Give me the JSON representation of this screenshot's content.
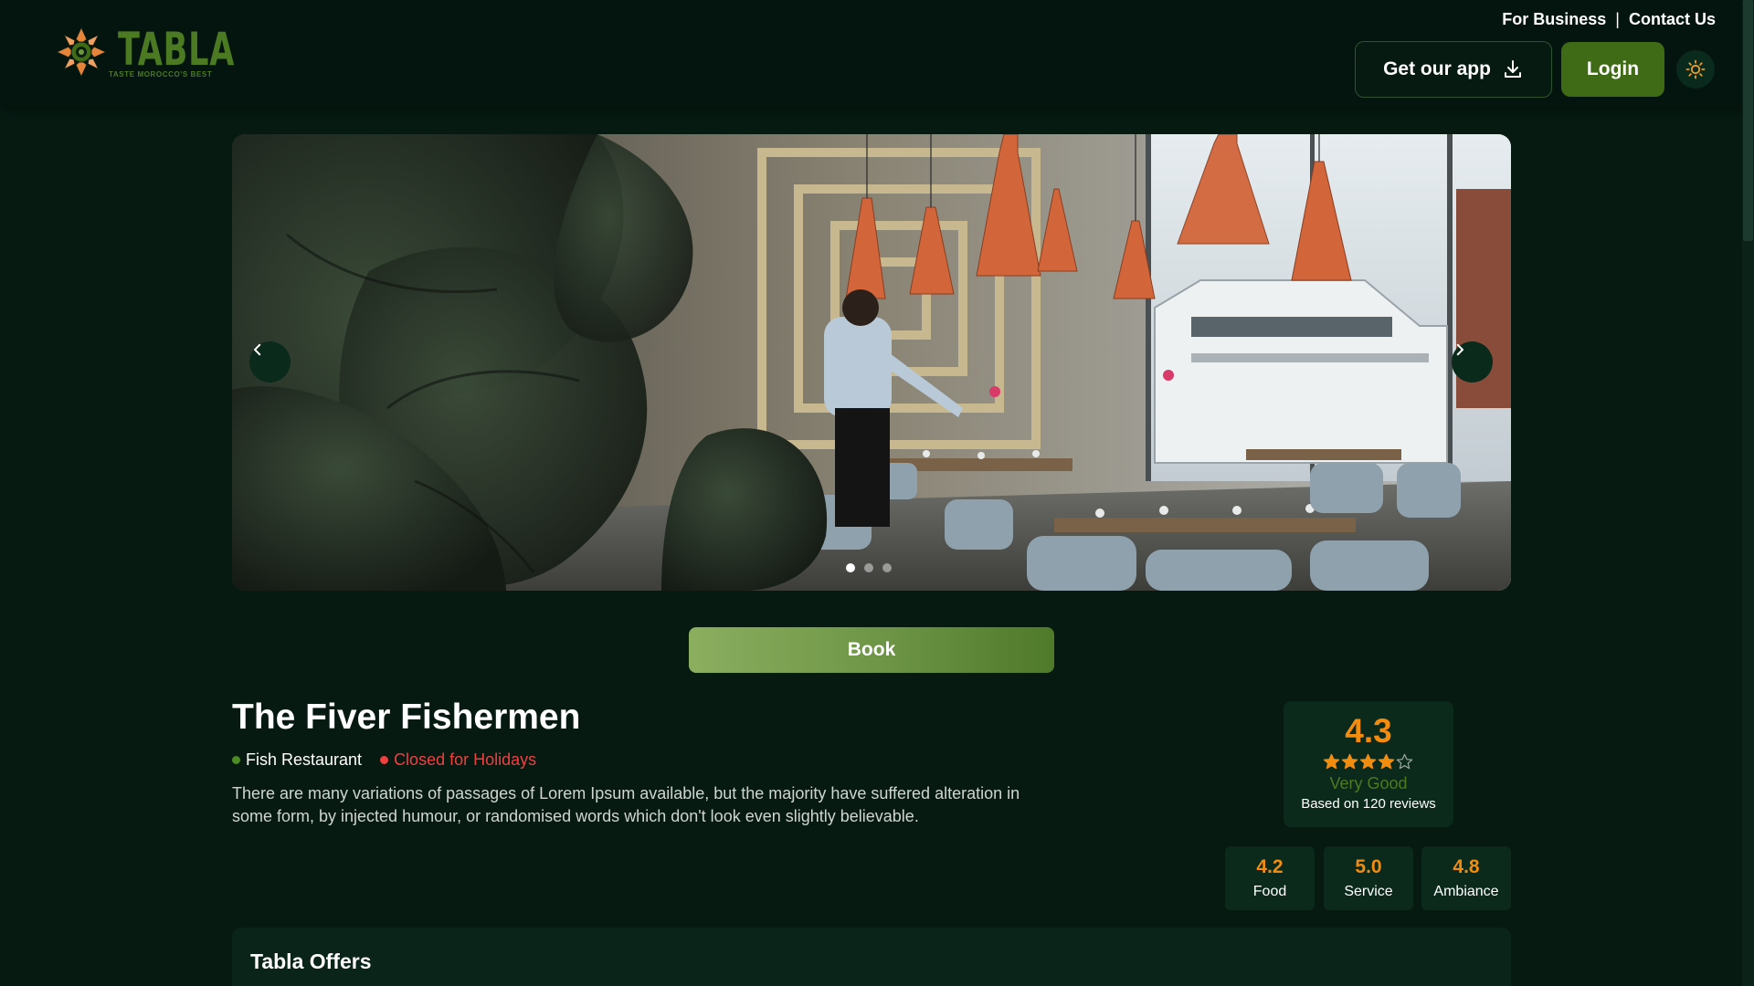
{
  "brand": {
    "name": "TABLA",
    "tagline": "TASTE MOROCCO'S BEST"
  },
  "header": {
    "links": {
      "business": "For Business",
      "separator": "|",
      "contact": "Contact Us"
    },
    "app_button": "Get our app",
    "login_button": "Login",
    "theme_icon": "sun-icon"
  },
  "hero": {
    "slide_count": 3,
    "active_slide": 1,
    "prev_icon": "chevron-left-icon",
    "next_icon": "chevron-right-icon"
  },
  "book_button": "Book",
  "restaurant": {
    "name": "The Fiver Fishermen",
    "category": "Fish Restaurant",
    "status": "Closed for Holidays",
    "description": "There are many variations of passages of Lorem Ipsum available, but the majority have suffered alteration in some form, by injected humour, or randomised words which don't look even slightly believable."
  },
  "rating": {
    "score": "4.3",
    "stars_value": 4.3,
    "stars_max": 5,
    "label": "Very Good",
    "reviews": "Based on 120 reviews"
  },
  "sub_ratings": [
    {
      "value": "4.2",
      "label": "Food"
    },
    {
      "value": "5.0",
      "label": "Service"
    },
    {
      "value": "4.8",
      "label": "Ambiance"
    }
  ],
  "offers": {
    "title": "Tabla Offers"
  },
  "colors": {
    "background": "#061a12",
    "accent_green": "#3f6b16",
    "rating_orange": "#f28c0f",
    "closed_red": "#ef4040"
  }
}
